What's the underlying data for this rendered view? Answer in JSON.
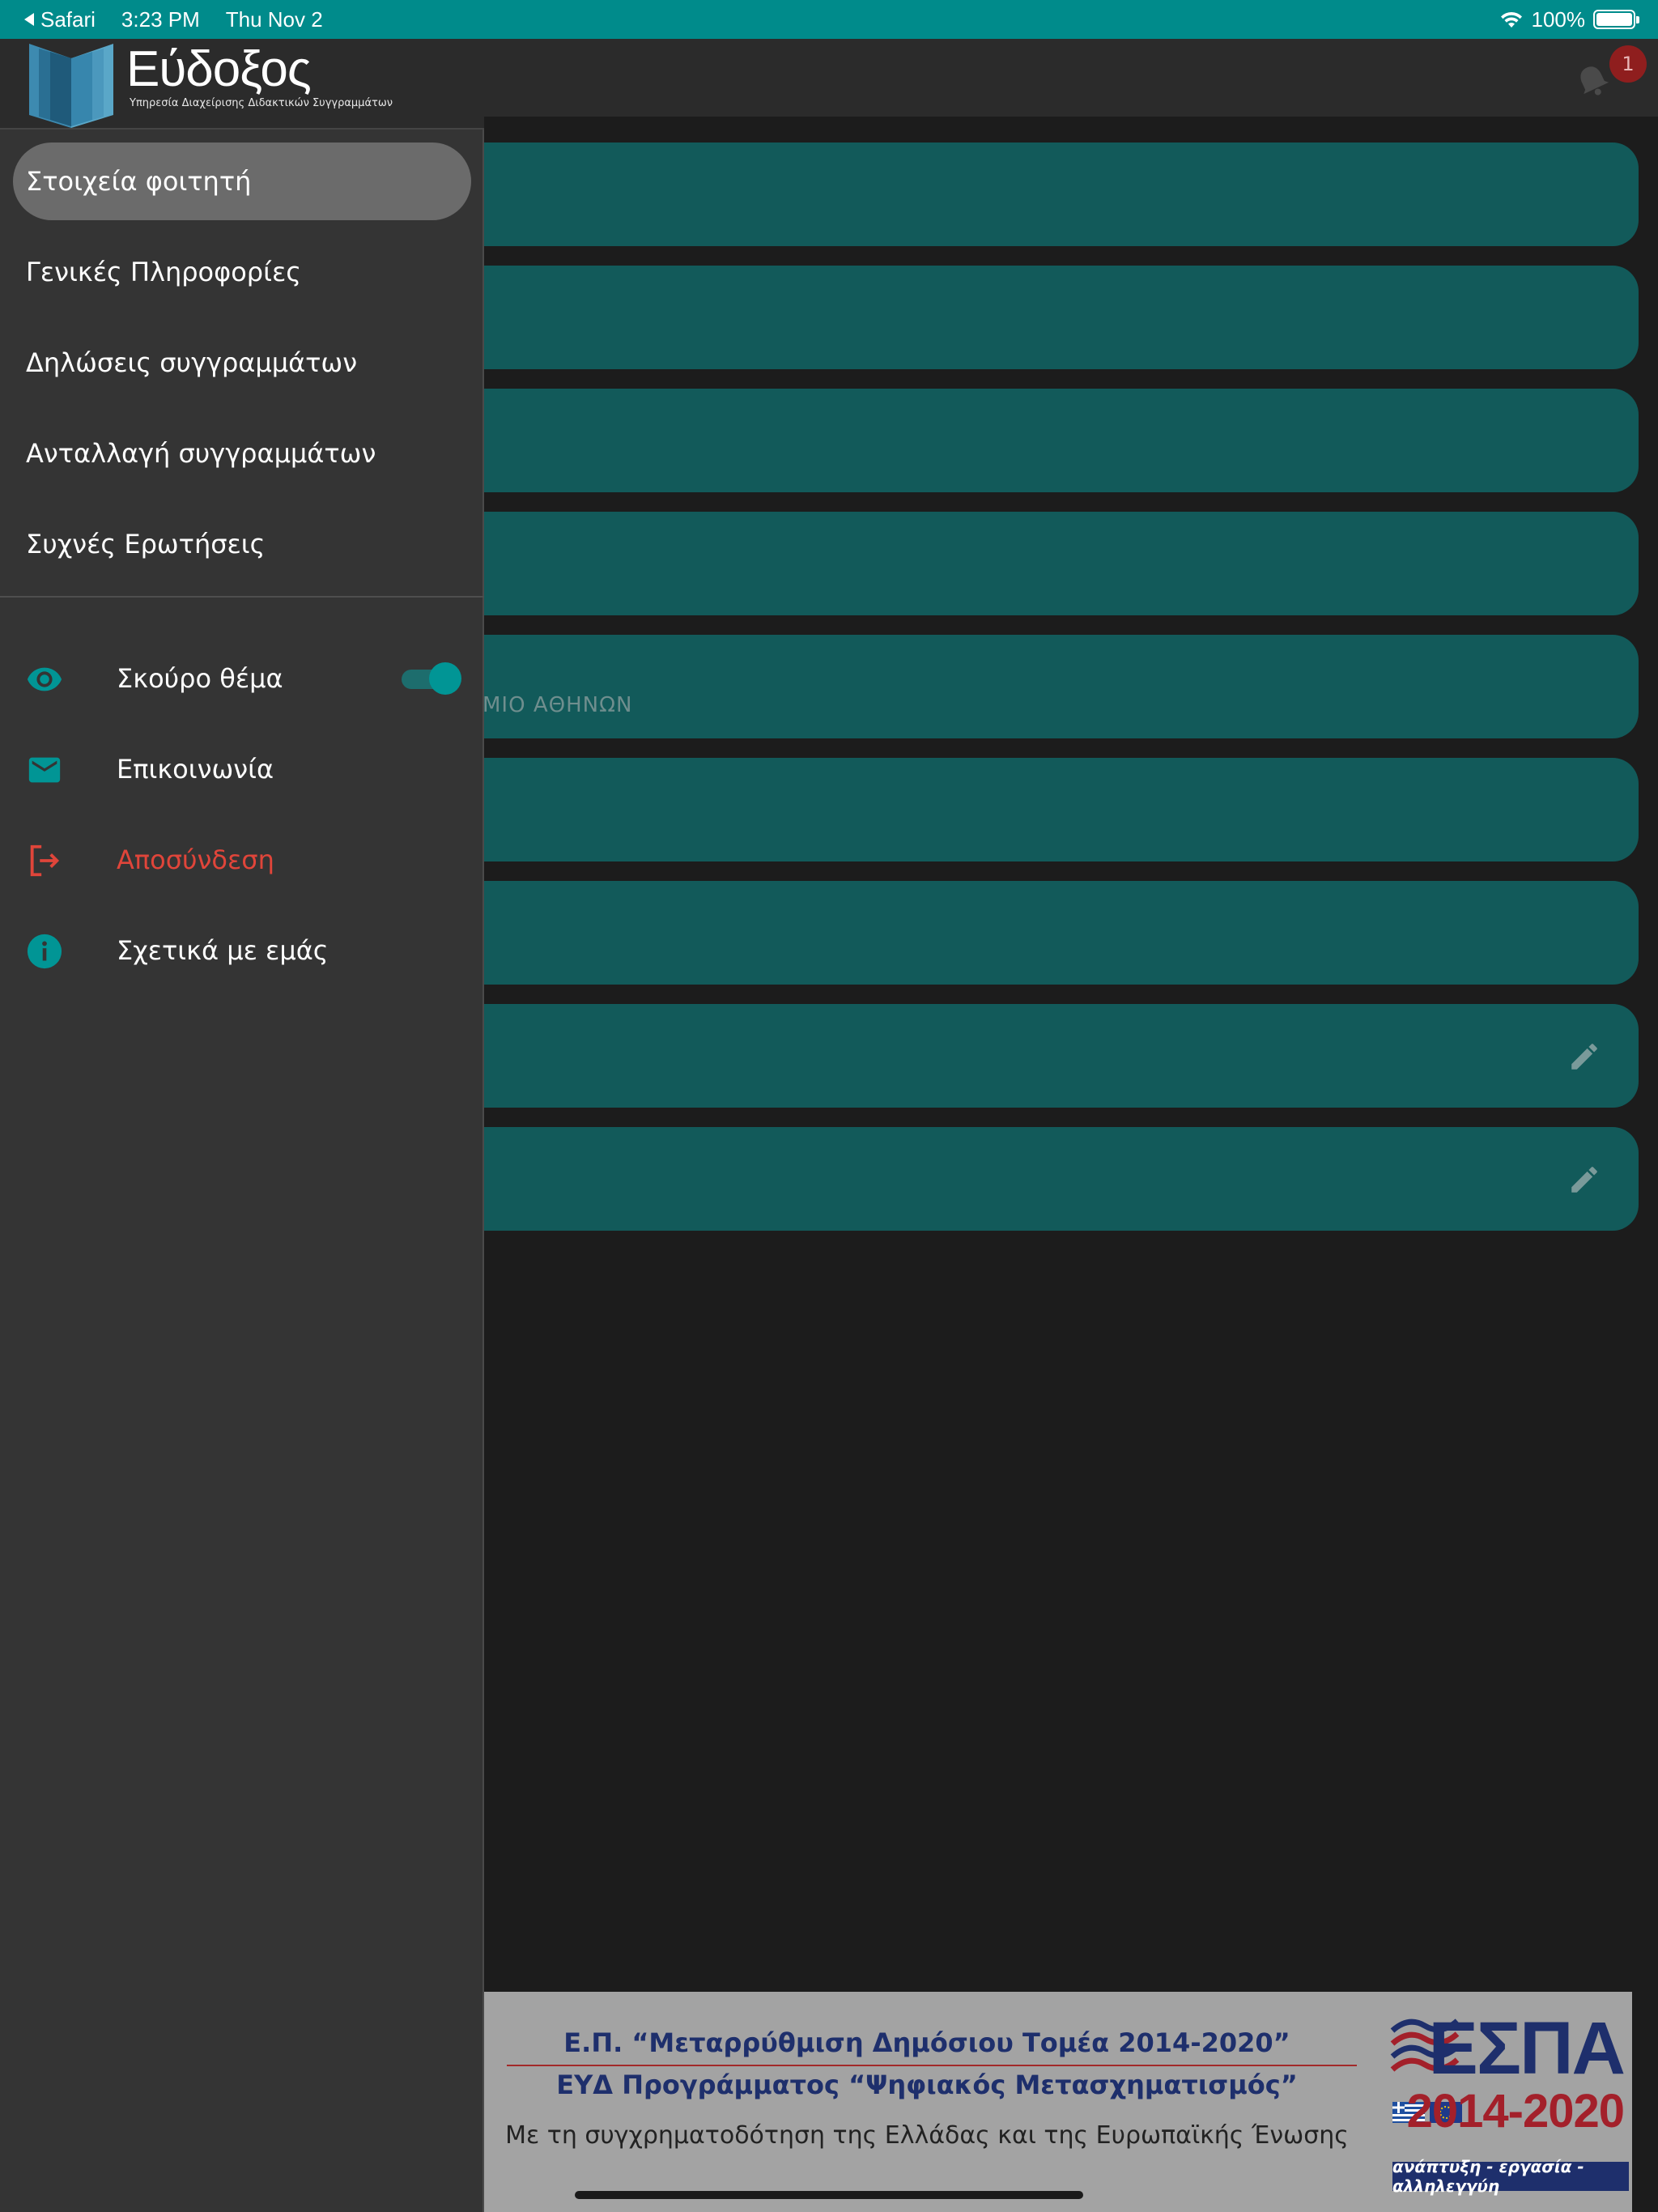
{
  "status_bar": {
    "back_app": "Safari",
    "time": "3:23 PM",
    "date": "Thu Nov 2",
    "battery": "100%"
  },
  "header": {
    "notification_count": "1"
  },
  "logo": {
    "title": "Εύδοξος",
    "subtitle": "Υπηρεσία Διαχείρισης Διδακτικών Συγγραμμάτων"
  },
  "drawer": {
    "nav_items": [
      {
        "label": "Στοιχεία φοιτητή",
        "active": true
      },
      {
        "label": "Γενικές Πληροφορίες"
      },
      {
        "label": "Δηλώσεις συγγραμμάτων"
      },
      {
        "label": "Ανταλλαγή συγγραμμάτων"
      },
      {
        "label": "Συχνές Ερωτήσεις"
      }
    ],
    "actions": [
      {
        "label": "Σκούρο θέμα",
        "icon": "eye-icon",
        "toggle_on": true
      },
      {
        "label": "Επικοινωνία",
        "icon": "mail-icon"
      },
      {
        "label": "Αποσύνδεση",
        "icon": "logout-icon"
      },
      {
        "label": "Σχετικά με εμάς",
        "icon": "info-icon"
      }
    ]
  },
  "cards": {
    "university_fragment": "ΜΙΟ ΑΘΗΝΩΝ"
  },
  "banner": {
    "line1": "Ε.Π. “Μεταρρύθμιση Δημόσιου Τομέα 2014-2020”",
    "line2": "ΕΥΔ Προγράμματος “Ψηφιακός Μετασχηματισμός”",
    "line3": "Με τη συγχρηματοδότηση της Ελλάδας και της Ευρωπαϊκής Ένωσης",
    "espa_title": "ΕΣΠΑ",
    "espa_years": "2014-2020",
    "espa_tagline": "ανάπτυξη - εργασία - αλληλεγγύη"
  },
  "colors": {
    "accent": "#008b8b",
    "card": "#125a5a",
    "drawer": "#343434",
    "danger": "#e0453a"
  }
}
